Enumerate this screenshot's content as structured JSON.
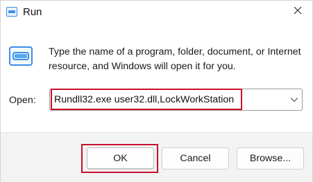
{
  "window": {
    "title": "Run",
    "title_icon": "run-icon",
    "close_icon": "close-icon"
  },
  "body": {
    "icon": "run-icon",
    "description": "Type the name of a program, folder, document, or Internet resource, and Windows will open it for you."
  },
  "open_field": {
    "label": "Open:",
    "value": "Rundll32.exe user32.dll,LockWorkStation",
    "dropdown_icon": "chevron-down-icon"
  },
  "buttons": {
    "ok": "OK",
    "cancel": "Cancel",
    "browse": "Browse..."
  },
  "colors": {
    "highlight": "#c8102e",
    "footer_bg": "#f3f3f3",
    "icon_blue": "#3a8ee6"
  }
}
